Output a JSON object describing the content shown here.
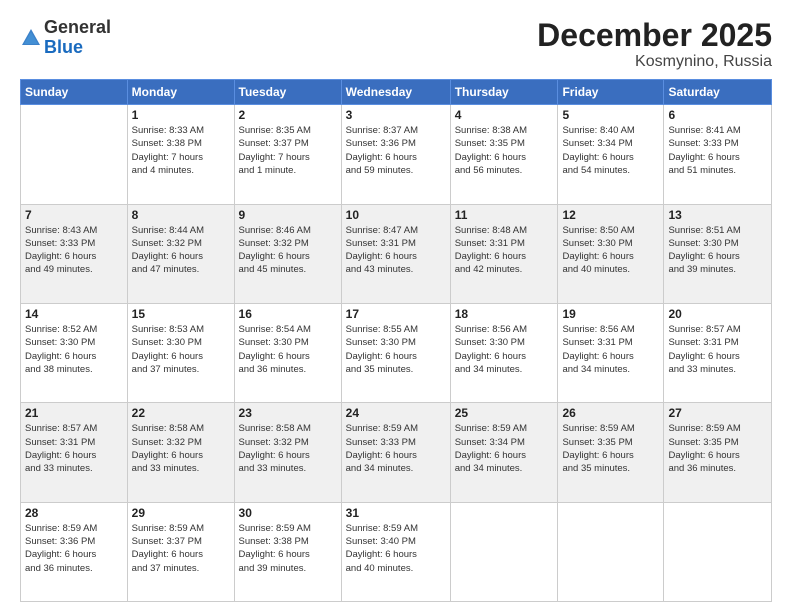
{
  "header": {
    "logo_line1": "General",
    "logo_line2": "Blue",
    "month_title": "December 2025",
    "location": "Kosmynino, Russia"
  },
  "weekdays": [
    "Sunday",
    "Monday",
    "Tuesday",
    "Wednesday",
    "Thursday",
    "Friday",
    "Saturday"
  ],
  "weeks": [
    [
      {
        "day": "",
        "info": ""
      },
      {
        "day": "1",
        "info": "Sunrise: 8:33 AM\nSunset: 3:38 PM\nDaylight: 7 hours\nand 4 minutes."
      },
      {
        "day": "2",
        "info": "Sunrise: 8:35 AM\nSunset: 3:37 PM\nDaylight: 7 hours\nand 1 minute."
      },
      {
        "day": "3",
        "info": "Sunrise: 8:37 AM\nSunset: 3:36 PM\nDaylight: 6 hours\nand 59 minutes."
      },
      {
        "day": "4",
        "info": "Sunrise: 8:38 AM\nSunset: 3:35 PM\nDaylight: 6 hours\nand 56 minutes."
      },
      {
        "day": "5",
        "info": "Sunrise: 8:40 AM\nSunset: 3:34 PM\nDaylight: 6 hours\nand 54 minutes."
      },
      {
        "day": "6",
        "info": "Sunrise: 8:41 AM\nSunset: 3:33 PM\nDaylight: 6 hours\nand 51 minutes."
      }
    ],
    [
      {
        "day": "7",
        "info": "Sunrise: 8:43 AM\nSunset: 3:33 PM\nDaylight: 6 hours\nand 49 minutes."
      },
      {
        "day": "8",
        "info": "Sunrise: 8:44 AM\nSunset: 3:32 PM\nDaylight: 6 hours\nand 47 minutes."
      },
      {
        "day": "9",
        "info": "Sunrise: 8:46 AM\nSunset: 3:32 PM\nDaylight: 6 hours\nand 45 minutes."
      },
      {
        "day": "10",
        "info": "Sunrise: 8:47 AM\nSunset: 3:31 PM\nDaylight: 6 hours\nand 43 minutes."
      },
      {
        "day": "11",
        "info": "Sunrise: 8:48 AM\nSunset: 3:31 PM\nDaylight: 6 hours\nand 42 minutes."
      },
      {
        "day": "12",
        "info": "Sunrise: 8:50 AM\nSunset: 3:30 PM\nDaylight: 6 hours\nand 40 minutes."
      },
      {
        "day": "13",
        "info": "Sunrise: 8:51 AM\nSunset: 3:30 PM\nDaylight: 6 hours\nand 39 minutes."
      }
    ],
    [
      {
        "day": "14",
        "info": "Sunrise: 8:52 AM\nSunset: 3:30 PM\nDaylight: 6 hours\nand 38 minutes."
      },
      {
        "day": "15",
        "info": "Sunrise: 8:53 AM\nSunset: 3:30 PM\nDaylight: 6 hours\nand 37 minutes."
      },
      {
        "day": "16",
        "info": "Sunrise: 8:54 AM\nSunset: 3:30 PM\nDaylight: 6 hours\nand 36 minutes."
      },
      {
        "day": "17",
        "info": "Sunrise: 8:55 AM\nSunset: 3:30 PM\nDaylight: 6 hours\nand 35 minutes."
      },
      {
        "day": "18",
        "info": "Sunrise: 8:56 AM\nSunset: 3:30 PM\nDaylight: 6 hours\nand 34 minutes."
      },
      {
        "day": "19",
        "info": "Sunrise: 8:56 AM\nSunset: 3:31 PM\nDaylight: 6 hours\nand 34 minutes."
      },
      {
        "day": "20",
        "info": "Sunrise: 8:57 AM\nSunset: 3:31 PM\nDaylight: 6 hours\nand 33 minutes."
      }
    ],
    [
      {
        "day": "21",
        "info": "Sunrise: 8:57 AM\nSunset: 3:31 PM\nDaylight: 6 hours\nand 33 minutes."
      },
      {
        "day": "22",
        "info": "Sunrise: 8:58 AM\nSunset: 3:32 PM\nDaylight: 6 hours\nand 33 minutes."
      },
      {
        "day": "23",
        "info": "Sunrise: 8:58 AM\nSunset: 3:32 PM\nDaylight: 6 hours\nand 33 minutes."
      },
      {
        "day": "24",
        "info": "Sunrise: 8:59 AM\nSunset: 3:33 PM\nDaylight: 6 hours\nand 34 minutes."
      },
      {
        "day": "25",
        "info": "Sunrise: 8:59 AM\nSunset: 3:34 PM\nDaylight: 6 hours\nand 34 minutes."
      },
      {
        "day": "26",
        "info": "Sunrise: 8:59 AM\nSunset: 3:35 PM\nDaylight: 6 hours\nand 35 minutes."
      },
      {
        "day": "27",
        "info": "Sunrise: 8:59 AM\nSunset: 3:35 PM\nDaylight: 6 hours\nand 36 minutes."
      }
    ],
    [
      {
        "day": "28",
        "info": "Sunrise: 8:59 AM\nSunset: 3:36 PM\nDaylight: 6 hours\nand 36 minutes."
      },
      {
        "day": "29",
        "info": "Sunrise: 8:59 AM\nSunset: 3:37 PM\nDaylight: 6 hours\nand 37 minutes."
      },
      {
        "day": "30",
        "info": "Sunrise: 8:59 AM\nSunset: 3:38 PM\nDaylight: 6 hours\nand 39 minutes."
      },
      {
        "day": "31",
        "info": "Sunrise: 8:59 AM\nSunset: 3:40 PM\nDaylight: 6 hours\nand 40 minutes."
      },
      {
        "day": "",
        "info": ""
      },
      {
        "day": "",
        "info": ""
      },
      {
        "day": "",
        "info": ""
      }
    ]
  ]
}
